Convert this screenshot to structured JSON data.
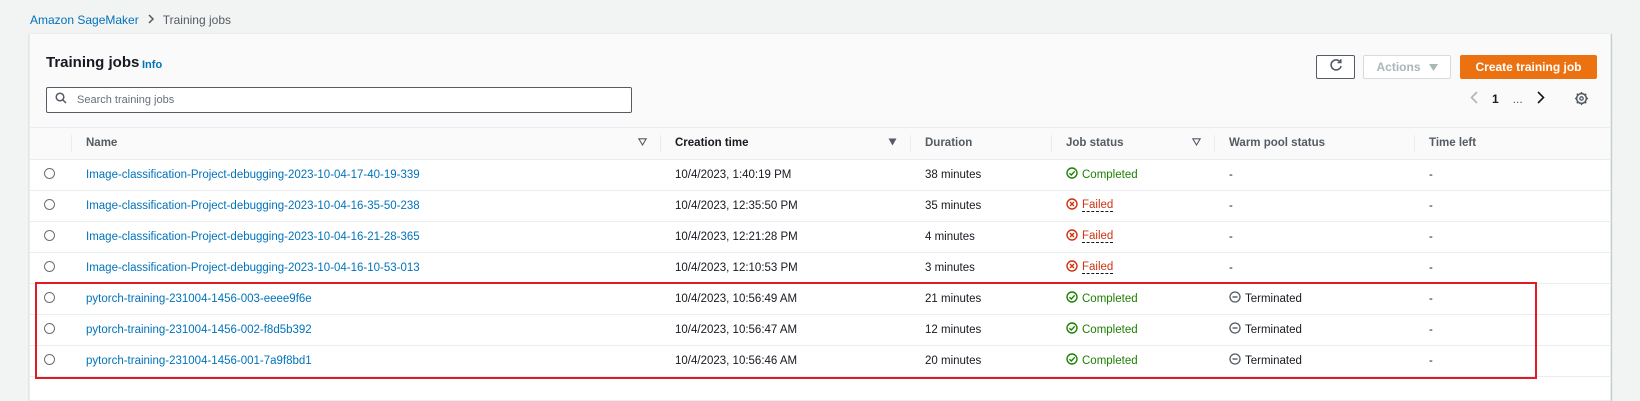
{
  "breadcrumb": {
    "root": "Amazon SageMaker",
    "current": "Training jobs"
  },
  "header": {
    "title": "Training jobs",
    "info": "Info",
    "actions_label": "Actions",
    "create_label": "Create training job"
  },
  "search": {
    "placeholder": "Search training jobs",
    "value": ""
  },
  "pagination": {
    "current_page": "1",
    "ellipsis": "..."
  },
  "table": {
    "columns": {
      "name": "Name",
      "creation_time": "Creation time",
      "duration": "Duration",
      "job_status": "Job status",
      "warm_pool_status": "Warm pool status",
      "time_left": "Time left"
    },
    "rows": [
      {
        "name": "Image-classification-Project-debugging-2023-10-04-17-40-19-339",
        "creation_time": "10/4/2023, 1:40:19 PM",
        "duration": "38 minutes",
        "status": "Completed",
        "warm_pool": "-",
        "time_left": "-"
      },
      {
        "name": "Image-classification-Project-debugging-2023-10-04-16-35-50-238",
        "creation_time": "10/4/2023, 12:35:50 PM",
        "duration": "35 minutes",
        "status": "Failed",
        "warm_pool": "-",
        "time_left": "-"
      },
      {
        "name": "Image-classification-Project-debugging-2023-10-04-16-21-28-365",
        "creation_time": "10/4/2023, 12:21:28 PM",
        "duration": "4 minutes",
        "status": "Failed",
        "warm_pool": "-",
        "time_left": "-"
      },
      {
        "name": "Image-classification-Project-debugging-2023-10-04-16-10-53-013",
        "creation_time": "10/4/2023, 12:10:53 PM",
        "duration": "3 minutes",
        "status": "Failed",
        "warm_pool": "-",
        "time_left": "-"
      },
      {
        "name": "pytorch-training-231004-1456-003-eeee9f6e",
        "creation_time": "10/4/2023, 10:56:49 AM",
        "duration": "21 minutes",
        "status": "Completed",
        "warm_pool": "Terminated",
        "time_left": "-"
      },
      {
        "name": "pytorch-training-231004-1456-002-f8d5b392",
        "creation_time": "10/4/2023, 10:56:47 AM",
        "duration": "12 minutes",
        "status": "Completed",
        "warm_pool": "Terminated",
        "time_left": "-"
      },
      {
        "name": "pytorch-training-231004-1456-001-7a9f8bd1",
        "creation_time": "10/4/2023, 10:56:46 AM",
        "duration": "20 minutes",
        "status": "Completed",
        "warm_pool": "Terminated",
        "time_left": "-"
      }
    ]
  },
  "colors": {
    "link": "#0073bb",
    "primary_button": "#ec7211",
    "success": "#1d8102",
    "error": "#d13212",
    "highlight": "#e01b24"
  },
  "icons": {
    "refresh": "refresh-icon",
    "search": "search-icon",
    "settings": "gear-icon",
    "completed": "check-circle-icon",
    "failed": "x-circle-icon",
    "terminated": "minus-circle-icon"
  }
}
